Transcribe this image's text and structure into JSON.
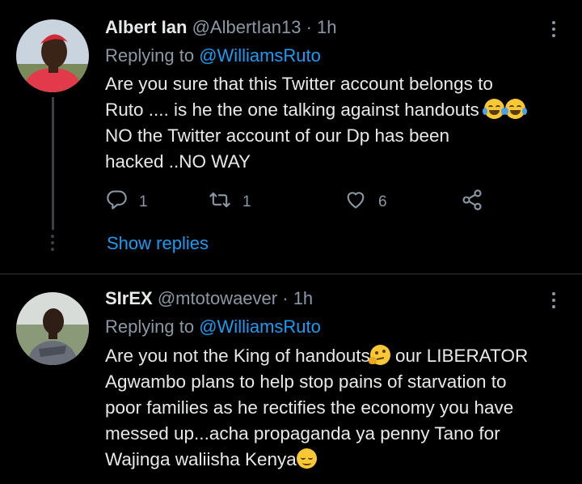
{
  "tweets": [
    {
      "name": "Albert Ian",
      "handle": "@AlbertIan13",
      "separator": "·",
      "time": "1h",
      "replying_prefix": "Replying to",
      "replying_to": "@WilliamsRuto",
      "text_lines": [
        "Are you sure that this Twitter account belongs to",
        "Ruto .... is he the one talking against handouts ",
        "NO the Twitter account  of our Dp has been",
        "hacked ..NO WAY"
      ],
      "stats": {
        "replies": "1",
        "retweets": "1",
        "likes": "6"
      },
      "show_replies": "Show replies"
    },
    {
      "name": "SIrEX",
      "handle": "@mtotowaever",
      "separator": "·",
      "time": "1h",
      "replying_prefix": "Replying to",
      "replying_to": "@WilliamsRuto",
      "text_lines": [
        "Are you not the King of handouts",
        " our LIBERATOR",
        "Agwambo plans to help stop pains of starvation to",
        "poor families as he rectifies the economy you have",
        "messed up...acha propaganda ya penny Tano for",
        "Wajinga waliisha Kenya"
      ]
    }
  ],
  "icons": {
    "reply": "reply-icon",
    "retweet": "retweet-icon",
    "like": "heart-icon",
    "share": "share-icon",
    "more": "more-options-icon"
  },
  "colors": {
    "background": "#000000",
    "link": "#1d9bf0",
    "muted": "#8b98a5",
    "text": "#e7e9ea"
  }
}
